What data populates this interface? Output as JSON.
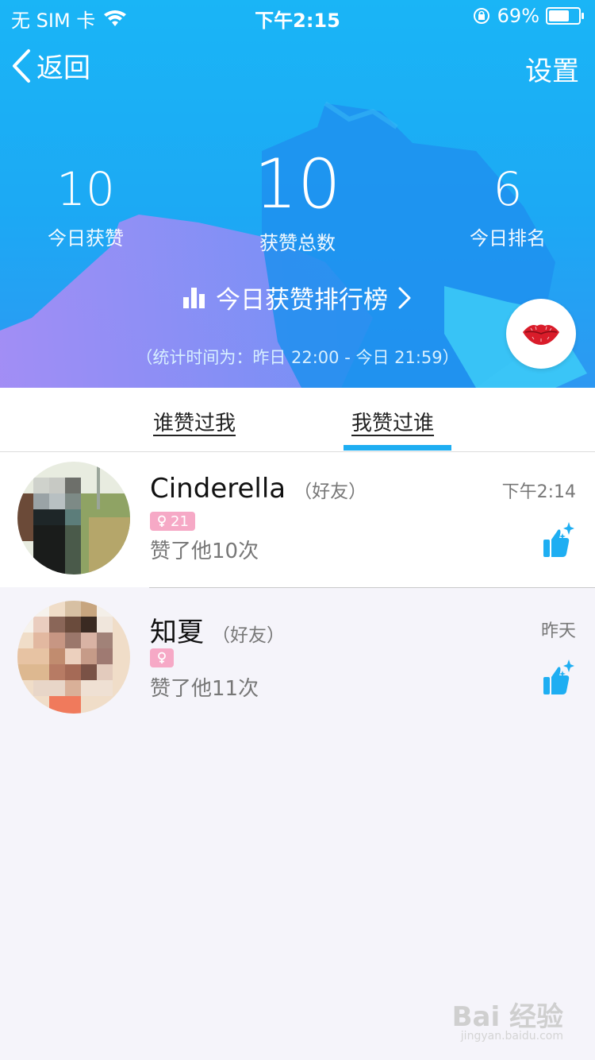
{
  "status_bar": {
    "carrier": "无 SIM 卡",
    "time": "下午2:15",
    "battery_percent": "69%",
    "battery_level": 0.69,
    "icons": [
      "wifi-icon",
      "rotation-lock-icon",
      "battery-icon"
    ]
  },
  "nav": {
    "back_label": "返回",
    "settings_label": "设置"
  },
  "stats": {
    "today_likes": {
      "value": "10",
      "label": "今日获赞"
    },
    "total_likes": {
      "value": "10",
      "label": "获赞总数"
    },
    "today_rank": {
      "value": "6",
      "label": "今日排名"
    }
  },
  "ranking": {
    "link_label": "今日获赞排行榜",
    "stat_time": "（统计时间为：昨日 22:00 - 今日 21:59）"
  },
  "tabs": [
    {
      "label": "谁赞过我",
      "active": false
    },
    {
      "label": "我赞过谁",
      "active": true
    }
  ],
  "list": [
    {
      "name": "Cinderella",
      "relation": "（好友）",
      "badge": "21",
      "gender": "female",
      "liked_text": "赞了他10次",
      "time": "下午2:14"
    },
    {
      "name": "知夏",
      "relation": "（好友）",
      "badge": "",
      "gender": "female",
      "liked_text": "赞了他11次",
      "time": "昨天"
    }
  ],
  "watermark": {
    "main": "Bai 经验",
    "sub": "jingyan.baidu.com"
  },
  "colors": {
    "header_blue": "#1ab5f6",
    "accent": "#1eaef2",
    "badge_pink": "#f6a9c6",
    "kiss_red": "#d91c2a"
  }
}
